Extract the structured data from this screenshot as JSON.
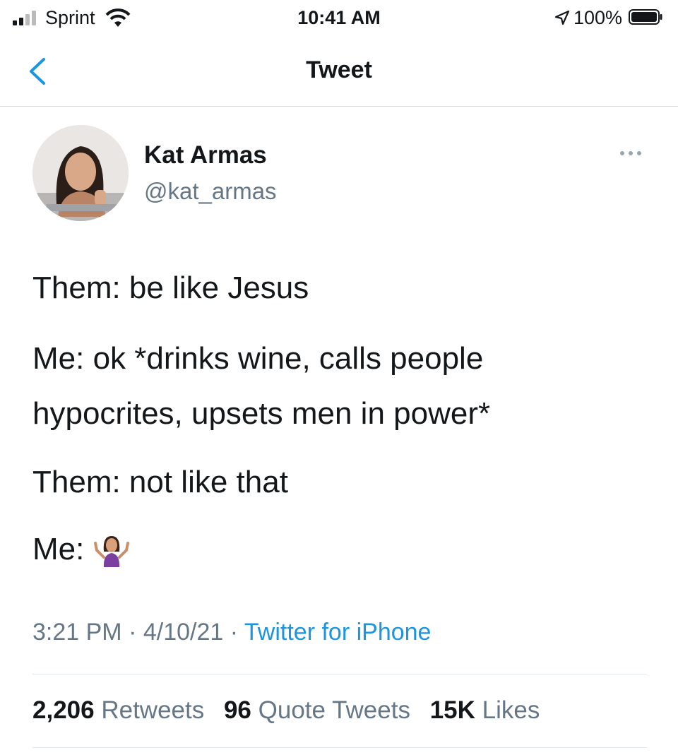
{
  "status_bar": {
    "carrier": "Sprint",
    "time": "10:41 AM",
    "battery": "100%"
  },
  "nav": {
    "title": "Tweet"
  },
  "tweet": {
    "author_name": "Kat Armas",
    "author_handle": "@kat_armas",
    "lines": [
      "Them: be like Jesus",
      "Me: ok *drinks wine, calls people",
      "hypocrites, upsets men in power*",
      "Them: not like that",
      "Me:"
    ],
    "emoji": "person-shrugging-emoji",
    "time": "3:21 PM",
    "date": "4/10/21",
    "source": "Twitter for iPhone"
  },
  "stats": {
    "retweets_count": "2,206",
    "retweets_label": "Retweets",
    "quotes_count": "96",
    "quotes_label": "Quote Tweets",
    "likes_count": "15K",
    "likes_label": "Likes"
  },
  "colors": {
    "text": "#14171a",
    "secondary": "#657786",
    "link": "#1b95e0",
    "emoji_purple": "#7b3fa0"
  }
}
